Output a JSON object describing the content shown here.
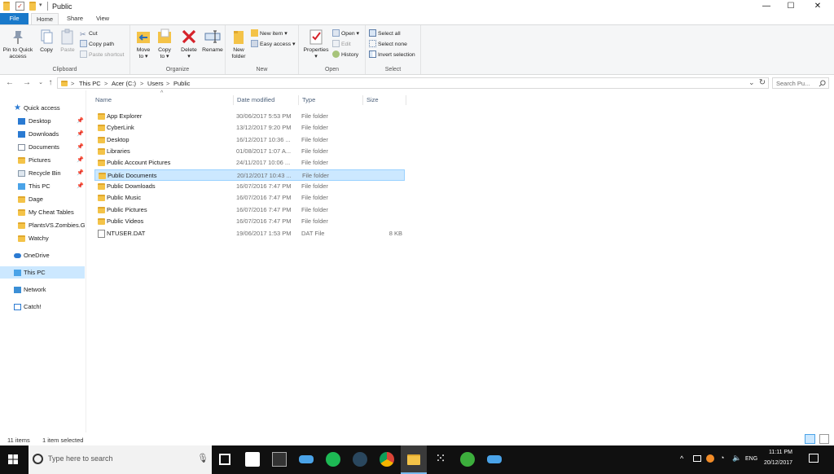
{
  "window": {
    "title": "Public",
    "controls": {
      "minimize": "—",
      "maximize": "☐",
      "close": "✕"
    }
  },
  "ribbon_tabs": [
    {
      "label": "File"
    },
    {
      "label": "Home"
    },
    {
      "label": "Share"
    },
    {
      "label": "View"
    }
  ],
  "ribbon": {
    "clipboard": {
      "label": "Clipboard",
      "pin": "Pin to Quick access",
      "pin_line1": "Pin to Quick",
      "pin_line2": "access",
      "copy": "Copy",
      "paste": "Paste",
      "cut": "Cut",
      "copy_path": "Copy path",
      "paste_shortcut": "Paste shortcut"
    },
    "organize": {
      "label": "Organize",
      "move_to": "Move",
      "move_to2": "to",
      "copy_to": "Copy",
      "copy_to2": "to",
      "delete": "Delete",
      "rename": "Rename"
    },
    "new": {
      "label": "New",
      "new_folder": "New",
      "new_folder2": "folder",
      "new_item": "New item",
      "easy_access": "Easy access"
    },
    "open": {
      "label": "Open",
      "properties": "Properties",
      "open": "Open",
      "edit": "Edit",
      "history": "History"
    },
    "select": {
      "label": "Select",
      "select_all": "Select all",
      "select_none": "Select none",
      "invert": "Invert selection"
    }
  },
  "address": {
    "crumbs": [
      "This PC",
      "Acer (C:)",
      "Users",
      "Public"
    ],
    "separator": ">",
    "search_placeholder": "Search Pu..."
  },
  "nav_pane": {
    "quick_access": "Quick access",
    "items": [
      {
        "label": "Desktop",
        "pinned": true
      },
      {
        "label": "Downloads",
        "pinned": true
      },
      {
        "label": "Documents",
        "pinned": true
      },
      {
        "label": "Pictures",
        "pinned": true
      },
      {
        "label": "Recycle Bin",
        "pinned": true
      },
      {
        "label": "This PC",
        "pinned": true
      },
      {
        "label": "Dage",
        "pinned": false
      },
      {
        "label": "My Cheat Tables",
        "pinned": false
      },
      {
        "label": "PlantsVS.Zombies.G",
        "pinned": false
      },
      {
        "label": "Watchy",
        "pinned": false
      }
    ],
    "onedrive": "OneDrive",
    "this_pc": "This PC",
    "network": "Network",
    "catch": "Catch!"
  },
  "columns": {
    "name": "Name",
    "date": "Date modified",
    "type": "Type",
    "size": "Size"
  },
  "files": [
    {
      "name": "App Explorer",
      "date": "30/06/2017 5:53 PM",
      "type": "File folder",
      "size": ""
    },
    {
      "name": "CyberLink",
      "date": "13/12/2017 9:20 PM",
      "type": "File folder",
      "size": ""
    },
    {
      "name": "Desktop",
      "date": "16/12/2017 10:36 ...",
      "type": "File folder",
      "size": ""
    },
    {
      "name": "Libraries",
      "date": "01/08/2017 1:07 A...",
      "type": "File folder",
      "size": ""
    },
    {
      "name": "Public Account Pictures",
      "date": "24/11/2017 10:06 ...",
      "type": "File folder",
      "size": ""
    },
    {
      "name": "Public Documents",
      "date": "20/12/2017 10:43 ...",
      "type": "File folder",
      "size": "",
      "selected": true
    },
    {
      "name": "Public Downloads",
      "date": "16/07/2016 7:47 PM",
      "type": "File folder",
      "size": ""
    },
    {
      "name": "Public Music",
      "date": "16/07/2016 7:47 PM",
      "type": "File folder",
      "size": ""
    },
    {
      "name": "Public Pictures",
      "date": "16/07/2016 7:47 PM",
      "type": "File folder",
      "size": ""
    },
    {
      "name": "Public Videos",
      "date": "16/07/2016 7:47 PM",
      "type": "File folder",
      "size": ""
    },
    {
      "name": "NTUSER.DAT",
      "date": "19/06/2017 1:53 PM",
      "type": "DAT File",
      "size": "8 KB"
    }
  ],
  "status": {
    "items": "11 items",
    "selected": "1 item selected"
  },
  "taskbar": {
    "search_placeholder": "Type here to search",
    "lang": "ENG",
    "time": "11:11 PM",
    "date": "20/12/2017"
  },
  "colors": {
    "file_tab": "#1979ca",
    "selection": "#cce8ff",
    "folder": "#f4c348",
    "taskbar": "#101010"
  }
}
